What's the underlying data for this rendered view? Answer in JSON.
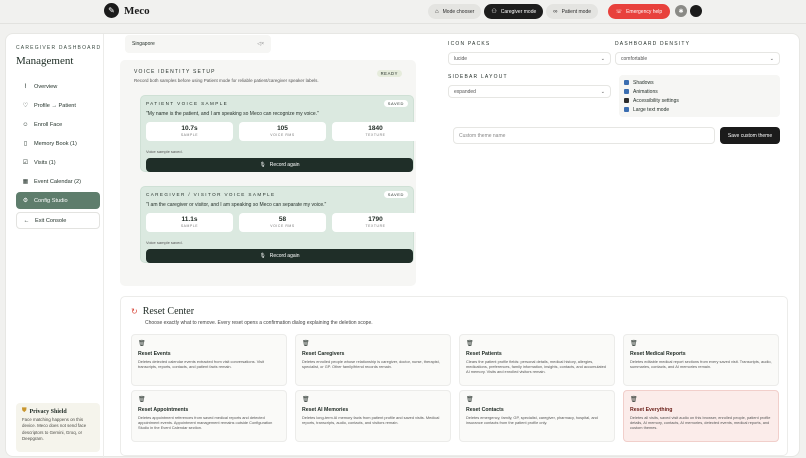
{
  "app": {
    "name": "Meco"
  },
  "modes": [
    {
      "label": "Mode chooser",
      "icon": "home-icon",
      "active": false
    },
    {
      "label": "Caregiver mode",
      "icon": "people-icon",
      "active": true
    },
    {
      "label": "Patient mode",
      "icon": "glasses-icon",
      "active": false
    }
  ],
  "emergency_label": "Emergency help",
  "sidebar": {
    "section_label": "CAREGIVER DASHBOARD",
    "title": "Management",
    "items": [
      {
        "label": "Overview",
        "icon": "chart-icon"
      },
      {
        "label": "Profile → Patient",
        "icon": "heart-icon"
      },
      {
        "label": "Enroll Face",
        "icon": "face-icon"
      },
      {
        "label": "Memory Book (1)",
        "icon": "book-icon"
      },
      {
        "label": "Visits (1)",
        "icon": "calendar-check-icon"
      },
      {
        "label": "Event Calendar (2)",
        "icon": "calendar-icon"
      },
      {
        "label": "Config Studio",
        "icon": "gear-icon"
      }
    ],
    "exit_label": "Exit Console",
    "privacy": {
      "title": "Privacy Shield",
      "text": "Face matching happens on this device. Meco does not send face descriptors to Gemini, Groq, or Deepgram."
    }
  },
  "singapore": {
    "label": "Singapore"
  },
  "voice_setup": {
    "heading": "VOICE IDENTITY SETUP",
    "subtitle": "Record both samples before using Patient mode for reliable patient/caregiver speaker labels.",
    "status": "READY",
    "patient": {
      "heading": "PATIENT VOICE SAMPLE",
      "status": "SAVED",
      "quote": "\"My name is the patient, and I am speaking so Meco can recognize my voice.\"",
      "stats": [
        {
          "value": "10.7s",
          "label": "SAMPLE"
        },
        {
          "value": "105",
          "label": "VOICE RMS"
        },
        {
          "value": "1840",
          "label": "TEXTURE"
        }
      ],
      "saved_note": "Voice sample saved.",
      "button": "Record again"
    },
    "caregiver": {
      "heading": "CAREGIVER / VISITOR VOICE SAMPLE",
      "status": "SAVED",
      "quote": "\"I am the caregiver or visitor, and I am speaking so Meco can separate my voice.\"",
      "stats": [
        {
          "value": "11.1s",
          "label": "SAMPLE"
        },
        {
          "value": "58",
          "label": "VOICE RMS"
        },
        {
          "value": "1790",
          "label": "TEXTURE"
        }
      ],
      "saved_note": "Voice sample saved.",
      "button": "Record again"
    }
  },
  "settings": {
    "icon_packs_label": "ICON PACKS",
    "icon_packs_value": "lucide",
    "density_label": "DASHBOARD DENSITY",
    "density_value": "comfortable",
    "sidebar_layout_label": "SIDEBAR LAYOUT",
    "sidebar_layout_value": "expanded",
    "toggles": [
      {
        "label": "Shadows",
        "checked": true
      },
      {
        "label": "Animations",
        "checked": true
      },
      {
        "label": "Accessibility settings",
        "checked": false
      },
      {
        "label": "Large text mode",
        "checked": true
      }
    ],
    "theme_placeholder": "Custom theme name",
    "save_theme": "Save custom theme"
  },
  "reset_center": {
    "title": "Reset Center",
    "subtitle": "Choose exactly what to remove. Every reset opens a confirmation dialog explaining the deletion scope.",
    "cards": [
      {
        "title": "Reset Events",
        "desc": "Deletes detected calendar events extracted from visit conversations. Visit transcripts, reports, contacts, and patient facts remain."
      },
      {
        "title": "Reset Caregivers",
        "desc": "Deletes enrolled people whose relationship is caregiver, doctor, nurse, therapist, specialist, or GP. Other family/friend records remain."
      },
      {
        "title": "Reset Patients",
        "desc": "Clears the patient profile fields: personal details, medical history, allergies, medications, preferences, family information, insights, contacts, and accumulated AI memory. Visits and enrolled visitors remain."
      },
      {
        "title": "Reset Medical Reports",
        "desc": "Deletes editable medical report sections from every saved visit. Transcripts, audio, summaries, contacts, and AI memories remain."
      },
      {
        "title": "Reset Appointments",
        "desc": "Deletes appointment references from saved medical reports and detected appointment events. Appointment management remains outside Configuration Studio in the Event Calendar section."
      },
      {
        "title": "Reset AI Memories",
        "desc": "Deletes long-term AI memory facts from patient profile and saved visits. Medical reports, transcripts, audio, contacts, and visitors remain."
      },
      {
        "title": "Reset Contacts",
        "desc": "Deletes emergency, family, GP, specialist, caregiver, pharmacy, hospital, and insurance contacts from the patient profile only."
      },
      {
        "title": "Reset Everything",
        "desc": "Deletes all visits, saved visit audio on this browser, enrolled people, patient profile details, AI memory, contacts, AI memories, detected events, medical reports, and custom themes."
      }
    ]
  }
}
